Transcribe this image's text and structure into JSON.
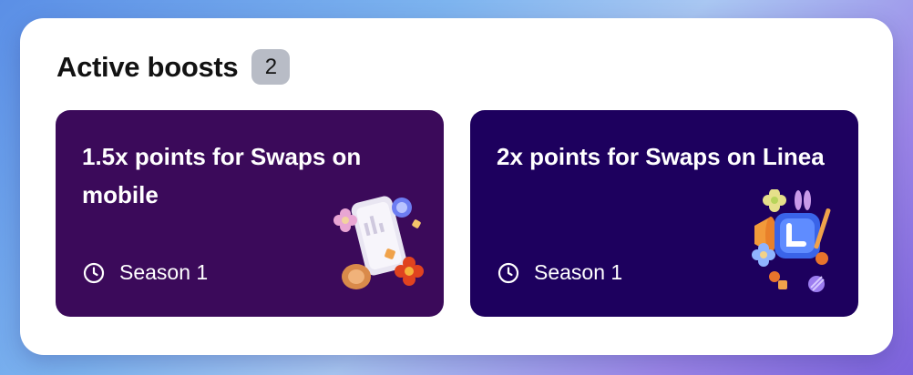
{
  "section": {
    "title": "Active boosts",
    "count": "2"
  },
  "boosts": [
    {
      "title": "1.5x points for Swaps on mobile",
      "season": "Season 1",
      "background": "#3b0a5a",
      "illustration": "phone-swap-illustration"
    },
    {
      "title": "2x points for Swaps on Linea",
      "season": "Season 1",
      "background": "#1d005e",
      "illustration": "linea-swap-illustration"
    }
  ],
  "colors": {
    "badge": "#b8bcc6",
    "card_text": "#ffffff"
  }
}
